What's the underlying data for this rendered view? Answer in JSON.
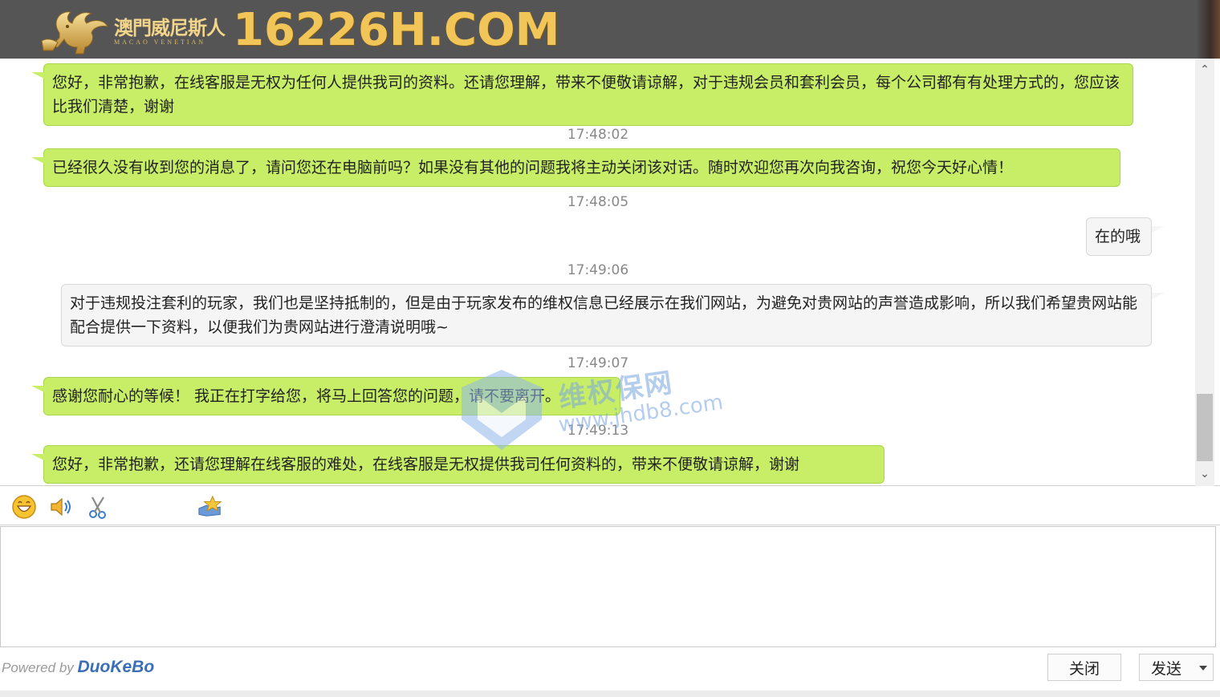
{
  "header": {
    "brand_cn": "澳門威尼斯人",
    "brand_en": "MACAO VENETIAN",
    "domain": "16226H.COM",
    "colors": {
      "header_bg": "#555555",
      "gold": "#f2c558"
    }
  },
  "messages": [
    {
      "sender": "agent",
      "text": "您好，非常抱歉，在线客服是无权为任何人提供我司的资料。还请您理解，带来不便敬请谅解，对于违规会员和套利会员，每个公司都有有处理方式的，您应该比我们清楚，谢谢"
    },
    {
      "sender": "agent",
      "time": "17:48:02",
      "text": "已经很久没有收到您的消息了，请问您还在电脑前吗？如果没有其他的问题我将主动关闭该对话。随时欢迎您再次向我咨询，祝您今天好心情！"
    },
    {
      "sender": "user",
      "time": "17:48:05",
      "text": "在的哦"
    },
    {
      "sender": "user",
      "time": "17:49:06",
      "text": "对于违规投注套利的玩家，我们也是坚持抵制的，但是由于玩家发布的维权信息已经展示在我们网站，为避免对贵网站的声誉造成影响，所以我们希望贵网站能配合提供一下资料，以便我们为贵网站进行澄清说明哦~"
    },
    {
      "sender": "agent",
      "time": "17:49:07",
      "text": "感谢您耐心的等候！ 我正在打字给您，将马上回答您的问题，请不要离开。"
    },
    {
      "sender": "agent",
      "time": "17:49:13",
      "text": "您好，非常抱歉，还请您理解在线客服的难处，在线客服是无权提供我司任何资料的，带来不便敬请谅解，谢谢"
    }
  ],
  "bubble_colors": {
    "agent": "#c7ee66",
    "user": "#f5f5f5"
  },
  "watermark": {
    "cn": "维权保网",
    "url": "www.jhdb8.com"
  },
  "toolbar": {
    "icons": [
      "emoji-icon",
      "sound-icon",
      "screenshot-scissors-icon",
      "rate-star-icon"
    ]
  },
  "input": {
    "value": "",
    "placeholder": ""
  },
  "footer": {
    "powered_by": "Powered by",
    "powered_brand": "DuoKeBo",
    "close_label": "关闭",
    "send_label": "发送"
  }
}
